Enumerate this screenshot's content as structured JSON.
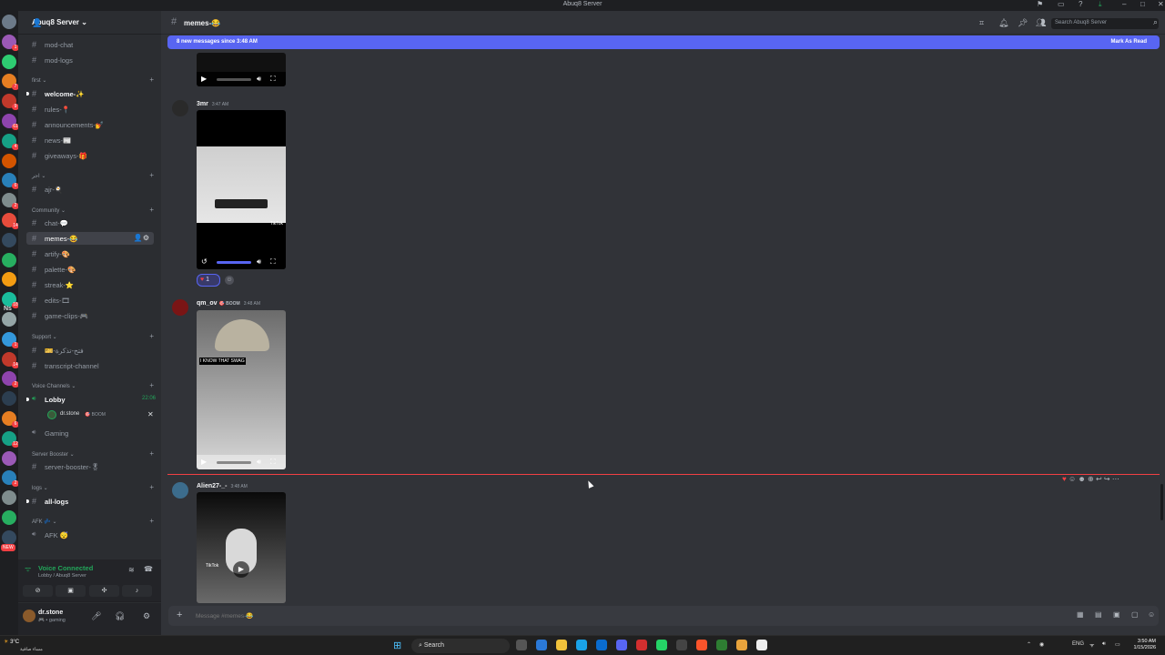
{
  "window": {
    "title": "Abuq8 Server"
  },
  "servers": [
    {
      "badge": ""
    },
    {
      "badge": "1"
    },
    {
      "badge": ""
    },
    {
      "badge": "7"
    },
    {
      "badge": "9"
    },
    {
      "badge": "61"
    },
    {
      "badge": "4"
    },
    {
      "badge": ""
    },
    {
      "badge": "6"
    },
    {
      "badge": "2"
    },
    {
      "badge": "14"
    },
    {
      "badge": ""
    },
    {
      "badge": ""
    },
    {
      "badge": ""
    },
    {
      "badge": "18"
    },
    {
      "badge": ""
    },
    {
      "badge": "1"
    },
    {
      "badge": "14"
    },
    {
      "badge": "2"
    },
    {
      "badge": ""
    },
    {
      "badge": "6"
    },
    {
      "badge": "12"
    },
    {
      "badge": ""
    },
    {
      "badge": "2"
    },
    {
      "badge": ""
    },
    {
      "badge": ""
    },
    {
      "badge": ""
    }
  ],
  "server_special": {
    "ns": "Ns",
    "new": "NEW"
  },
  "sidebar": {
    "server_name": "Abuq8 Server ⌄",
    "channels": [
      {
        "type": "ch",
        "name": "mod-chat"
      },
      {
        "type": "ch",
        "name": "mod-logs"
      },
      {
        "type": "cat",
        "name": "first ⌄"
      },
      {
        "type": "ch",
        "name": "welcome-✨",
        "unread": true
      },
      {
        "type": "ch",
        "name": "rules-📍"
      },
      {
        "type": "ch",
        "name": "announcements-💅"
      },
      {
        "type": "ch",
        "name": "news-📰"
      },
      {
        "type": "ch",
        "name": "giveaways-🎁"
      },
      {
        "type": "cat",
        "name": "اجر ⌄"
      },
      {
        "type": "ch",
        "name": "ajr-🍳"
      },
      {
        "type": "cat",
        "name": "Community ⌄"
      },
      {
        "type": "ch",
        "name": "chat-💬"
      },
      {
        "type": "ch",
        "name": "memes-😂",
        "selected": true
      },
      {
        "type": "ch",
        "name": "artify-🎨"
      },
      {
        "type": "ch",
        "name": "palette-🎨"
      },
      {
        "type": "ch",
        "name": "streak-⭐"
      },
      {
        "type": "ch",
        "name": "edits-🎞"
      },
      {
        "type": "ch",
        "name": "game-clips-🎮"
      },
      {
        "type": "cat",
        "name": "Support ⌄"
      },
      {
        "type": "ch",
        "name": "🎫-فتح-تذكرة"
      },
      {
        "type": "ch",
        "name": "transcript-channel"
      },
      {
        "type": "cat",
        "name": "Voice Channels ⌄"
      },
      {
        "type": "voice",
        "name": "Lobby",
        "time": "22:06",
        "unread": true
      },
      {
        "type": "vuser",
        "name": "dr.stone",
        "tag": "🎯 BOOM"
      },
      {
        "type": "voice",
        "name": "Gaming"
      },
      {
        "type": "cat",
        "name": "Server Booster ⌄"
      },
      {
        "type": "ch",
        "name": "server-booster-🎖"
      },
      {
        "type": "cat",
        "name": "logs ⌄"
      },
      {
        "type": "ch",
        "name": "all-logs",
        "unread": true
      },
      {
        "type": "cat",
        "name": "AFK 💤 ⌄"
      },
      {
        "type": "voice",
        "name": "AFK 😴"
      }
    ],
    "voice_connected": {
      "status": "Voice Connected",
      "sub": "Lobby / Abuq8 Server"
    },
    "user": {
      "name": "dr.stone",
      "status": "🎮 • gaming"
    }
  },
  "channel": {
    "name": "memes-😂",
    "search_placeholder": "Search Abuq8 Server",
    "new_messages": "8 new messages since 3:48 AM",
    "mark_read": "Mark As Read"
  },
  "messages": [
    {
      "author": "3mr",
      "time": "3:47 AM",
      "reaction_count": "1",
      "media_caption": "TikTok"
    },
    {
      "author": "qm_ov",
      "tag": "🎯 BOOM",
      "time": "3:48 AM",
      "media_caption": "I KNOW THAT SWAG"
    },
    {
      "author": "Alien27-_-",
      "time": "3:48 AM",
      "media_caption": "TikTok"
    }
  ],
  "composer": {
    "placeholder": "Message #memes-😂"
  },
  "taskbar": {
    "weather": "3°C",
    "weather_sub": "مساء صافية",
    "search": "Search",
    "lang": "ENG",
    "time": "3:50 AM",
    "date": "1/15/2026"
  },
  "colors": {
    "accent": "#5865f2",
    "unread_line": "#f23f43",
    "voice_green": "#23a55a"
  }
}
